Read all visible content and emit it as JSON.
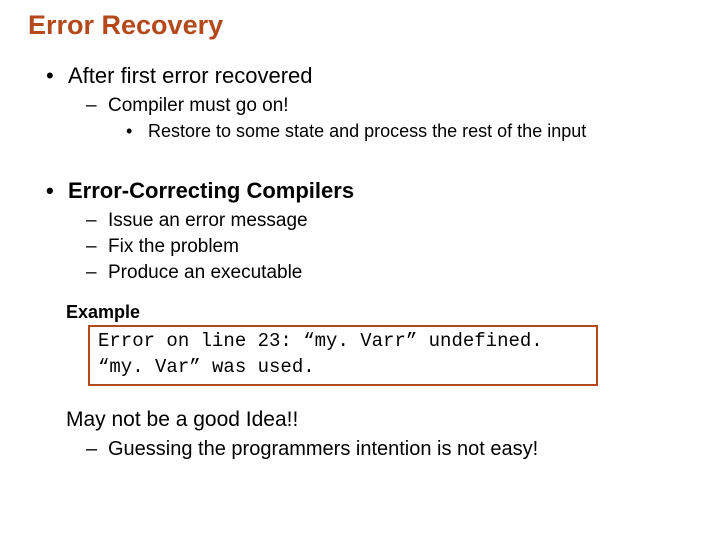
{
  "title": "Error Recovery",
  "b1": "After first error recovered",
  "b1_1": "Compiler must go on!",
  "b1_1_1": "Restore to some state and process the rest of the input",
  "b2": "Error-Correcting Compilers",
  "b2_1": "Issue an error message",
  "b2_2": "Fix the problem",
  "b2_3": "Produce an executable",
  "example_label": "Example",
  "example_line1": "Error on line 23: “my. Varr” undefined.",
  "example_line2": "“my. Var” was used.",
  "closing": "May not be a good Idea!!",
  "closing_sub": "Guessing the programmers intention is not easy!"
}
